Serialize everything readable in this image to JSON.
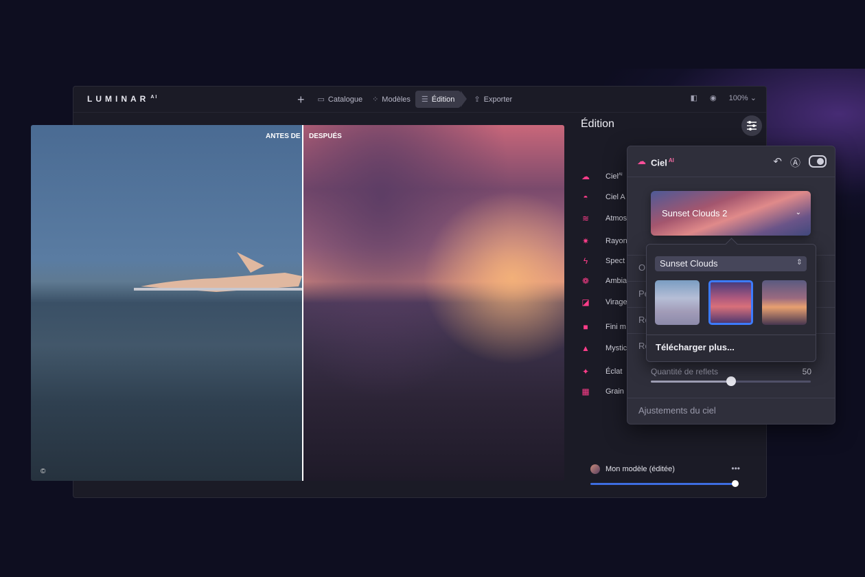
{
  "app": {
    "logo": "LUMINAR",
    "logo_sup": "AI"
  },
  "nav": {
    "items": [
      {
        "label": "Catalogue",
        "icon": "folder-icon"
      },
      {
        "label": "Modèles",
        "icon": "templates-icon"
      },
      {
        "label": "Édition",
        "icon": "sliders-icon",
        "active": true
      },
      {
        "label": "Exporter",
        "icon": "export-icon"
      }
    ],
    "zoom": "100%"
  },
  "photo": {
    "before_label": "ANTES DE",
    "after_label": "DESPUÉS",
    "copyright": "©"
  },
  "panel": {
    "title": "Édition",
    "tools": [
      {
        "label": "Ciel",
        "sup": "AI",
        "icon": "cloud-icon"
      },
      {
        "label": "Ciel A",
        "icon": "sky-augment-icon"
      },
      {
        "label": "Atmos",
        "icon": "atmosphere-icon"
      },
      {
        "label": "Rayon",
        "icon": "sunrays-icon"
      },
      {
        "label": "Spect",
        "icon": "lightning-icon"
      },
      {
        "label": "Ambia",
        "icon": "ambiance-icon"
      },
      {
        "label": "Virage",
        "icon": "toning-icon"
      },
      {
        "label": "Fini m",
        "icon": "matte-icon"
      },
      {
        "label": "Mystic",
        "icon": "mystical-icon"
      },
      {
        "label": "Éclat",
        "icon": "glow-icon"
      },
      {
        "label": "Grain",
        "icon": "grain-icon"
      }
    ],
    "model_name": "Mon modèle (éditée)",
    "model_amount": 100
  },
  "sky_panel": {
    "title": "Ciel",
    "title_sup": "AI",
    "selected_sky": "Sunset Clouds 2",
    "hidden_rows": [
      "O",
      "Pe",
      "Re",
      "Re"
    ],
    "reflection_label": "Quantité de reflets",
    "reflection_value": "50",
    "footer": "Ajustements du ciel"
  },
  "dropdown": {
    "pack": "Sunset Clouds",
    "thumbnails": [
      "sky-thumb-1",
      "sky-thumb-2",
      "sky-thumb-3"
    ],
    "selected_index": 1,
    "download_more": "Télécharger plus..."
  },
  "colors": {
    "accent": "#ff3d8a",
    "selection": "#3d7bff"
  }
}
